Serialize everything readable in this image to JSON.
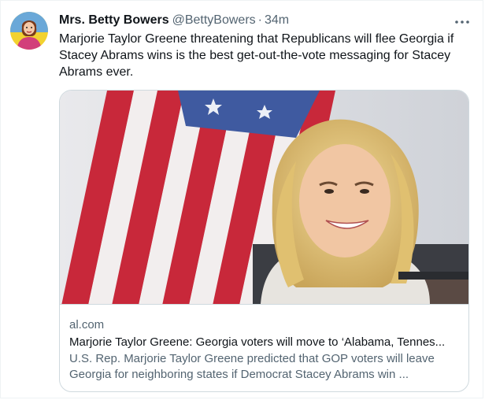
{
  "author": {
    "display_name": "Mrs. Betty Bowers",
    "handle": "@BettyBowers",
    "separator": "·",
    "time": "34m"
  },
  "tweet": {
    "text": "Marjorie Taylor Greene threatening that Republicans will flee Georgia if Stacey Abrams wins is the best get-out-the-vote messaging for Stacey Abrams ever."
  },
  "card": {
    "domain": "al.com",
    "title": "Marjorie Taylor Greene: Georgia voters will move to ‘Alabama, Tennes...",
    "description": "U.S. Rep. Marjorie Taylor Greene predicted that GOP voters will leave Georgia for neighboring states if Democrat Stacey Abrams win ..."
  },
  "icons": {
    "more": "more-horizontal-icon",
    "avatar": "cartoon-avatar"
  },
  "colors": {
    "text_primary": "#0f1419",
    "text_secondary": "#536471",
    "border": "#cfd9de",
    "flag_red": "#c8283a",
    "flag_blue": "#3f5aa0"
  }
}
